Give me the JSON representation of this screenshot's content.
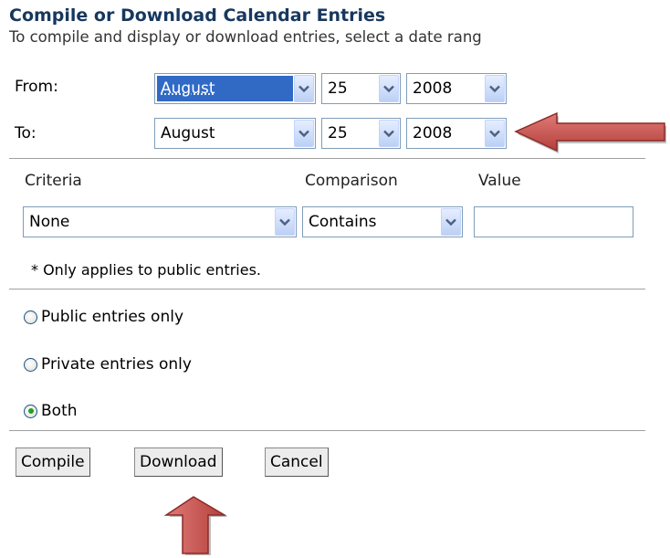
{
  "header": {
    "title": "Compile or Download Calendar Entries",
    "subtitle": "To compile and display or download entries, select a date rang"
  },
  "from": {
    "label": "From:",
    "month": "August",
    "day": "25",
    "year": "2008"
  },
  "to": {
    "label": "To:",
    "month": "August",
    "day": "25",
    "year": "2008"
  },
  "filter": {
    "criteria_label": "Criteria",
    "comparison_label": "Comparison",
    "value_label": "Value",
    "criteria_selected": "None",
    "comparison_selected": "Contains",
    "value": "",
    "note": "* Only applies to public entries."
  },
  "visibility": {
    "options": [
      "Public entries only",
      "Private entries only",
      "Both"
    ],
    "selected": "Both"
  },
  "buttons": {
    "compile": "Compile",
    "download": "Download",
    "cancel": "Cancel"
  },
  "colors": {
    "title": "#17375e",
    "arrow": "#c0504d",
    "selection": "#316ac5"
  }
}
